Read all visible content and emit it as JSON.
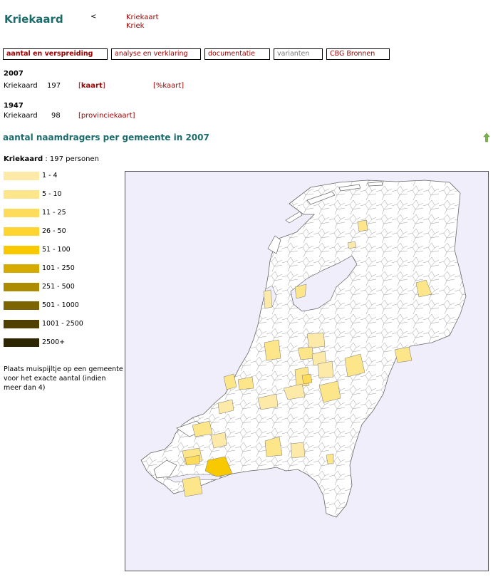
{
  "header": {
    "title": "Kriekaard",
    "back_label": "<",
    "variants": [
      "Kriekaart",
      "Kriek"
    ]
  },
  "tabs": [
    {
      "label": "aantal en verspreiding",
      "state": "active"
    },
    {
      "label": "analyse en verklaring",
      "state": "normal"
    },
    {
      "label": "documentatie",
      "state": "normal"
    },
    {
      "label": "varianten",
      "state": "disabled"
    },
    {
      "label": "CBG Bronnen",
      "state": "normal"
    }
  ],
  "counts": {
    "y2007": {
      "year": "2007",
      "name": "Kriekaard",
      "count": "197",
      "map_link": "kaart",
      "pct_link": "[%kaart]"
    },
    "y1947": {
      "year": "1947",
      "name": "Kriekaard",
      "count": "98",
      "map_link": "[provinciekaart]"
    }
  },
  "section_title": "aantal naamdragers per gemeente in 2007",
  "summary": {
    "name": "Kriekaard",
    "text": " : 197 personen"
  },
  "legend": [
    {
      "label": "1 - 4",
      "color": "#fdeaa8"
    },
    {
      "label": "5 - 10",
      "color": "#fde68a"
    },
    {
      "label": "11 - 25",
      "color": "#fddc5c"
    },
    {
      "label": "26 - 50",
      "color": "#fdd430"
    },
    {
      "label": "51 - 100",
      "color": "#f8c800"
    },
    {
      "label": "101 - 250",
      "color": "#d6ab00"
    },
    {
      "label": "251 - 500",
      "color": "#ad8b00"
    },
    {
      "label": "501 - 1000",
      "color": "#7c6500"
    },
    {
      "label": "1001 - 2500",
      "color": "#4f4000"
    },
    {
      "label": "2500+",
      "color": "#2e2600"
    }
  ],
  "hint": "Plaats muispijltje op een gemeente voor het exacte aantal (indien meer dan 4)",
  "colors": {
    "heading": "#1b6b6b",
    "link": "#a00000",
    "map_bg": "#efeefa",
    "land": "#ffffff",
    "border": "#888888"
  }
}
